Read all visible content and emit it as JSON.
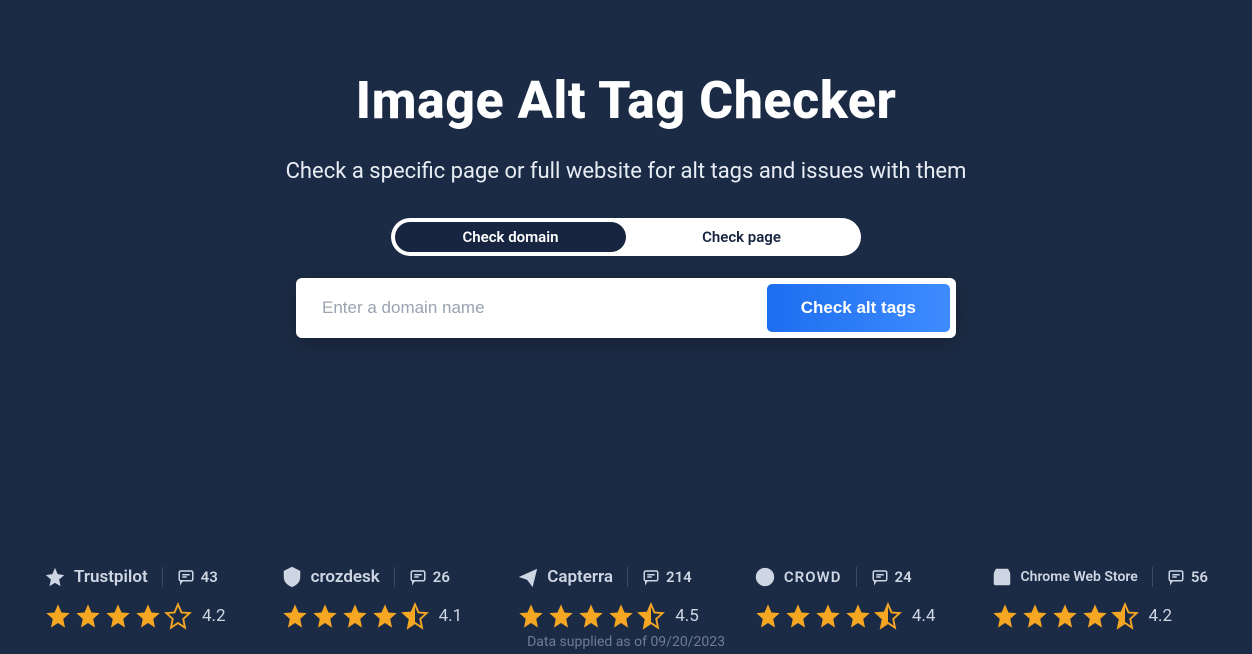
{
  "hero": {
    "title": "Image Alt Tag Checker",
    "subtitle": "Check a specific page or full website for alt tags and issues with them"
  },
  "toggle": {
    "domain": "Check domain",
    "page": "Check page"
  },
  "search": {
    "placeholder": "Enter a domain name",
    "button": "Check alt tags"
  },
  "ratings": [
    {
      "brand": "Trustpilot",
      "reviews": "43",
      "score": "4.2",
      "stars": 4
    },
    {
      "brand": "crozdesk",
      "reviews": "26",
      "score": "4.1",
      "stars": 4.5
    },
    {
      "brand": "Capterra",
      "reviews": "214",
      "score": "4.5",
      "stars": 4.5
    },
    {
      "brand": "CROWD",
      "reviews": "24",
      "score": "4.4",
      "stars": 4.5
    },
    {
      "brand": "Chrome Web Store",
      "reviews": "56",
      "score": "4.2",
      "stars": 4.5
    }
  ],
  "footer": {
    "supplied": "Data supplied as of 09/20/2023"
  }
}
